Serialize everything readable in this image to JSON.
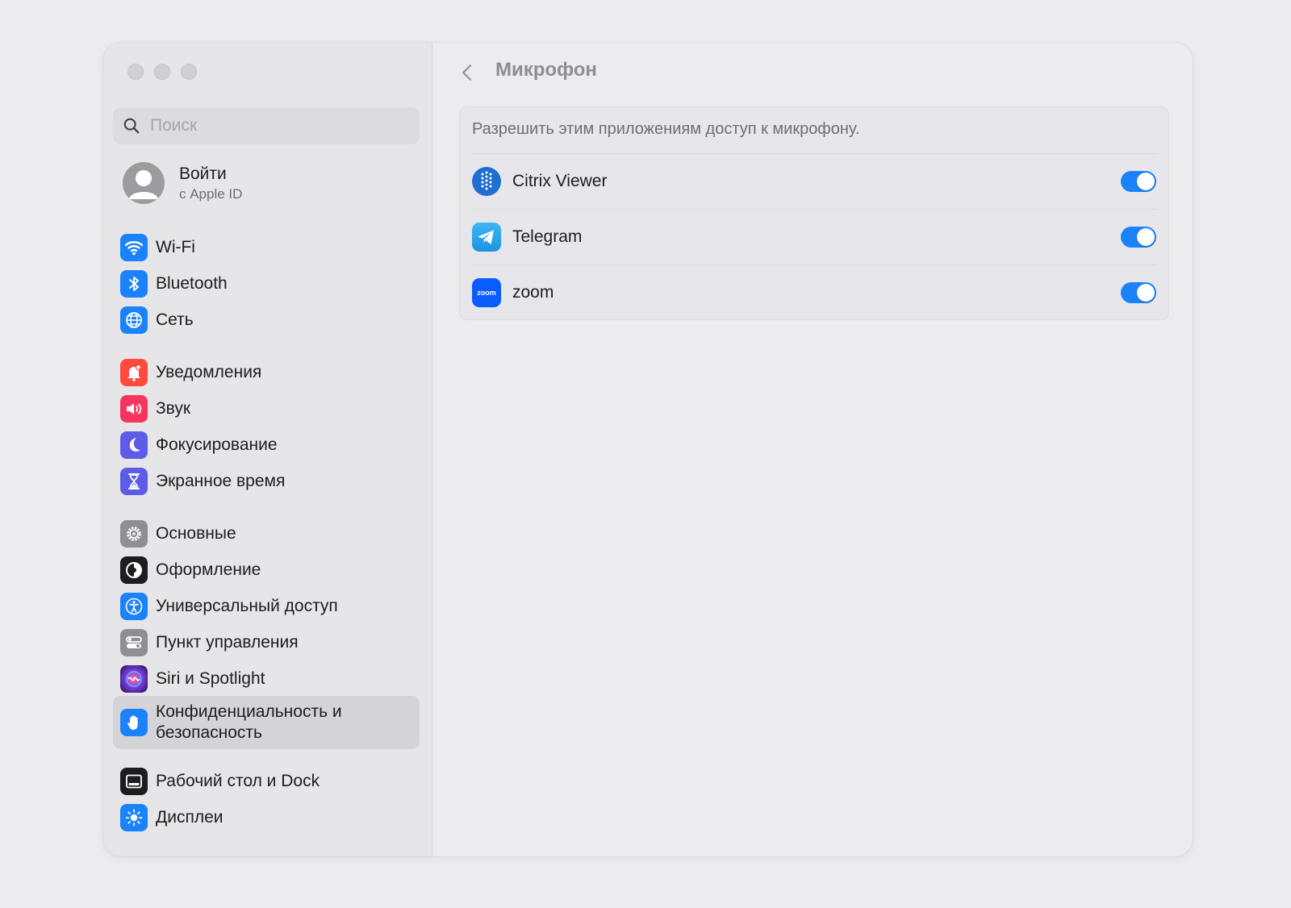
{
  "window": {
    "traffic_lights": [
      "close",
      "minimize",
      "zoom"
    ]
  },
  "sidebar": {
    "search": {
      "placeholder": "Поиск",
      "value": ""
    },
    "account": {
      "name": "Войти",
      "sub": "с Apple ID"
    },
    "items": [
      {
        "label": "Wi-Fi",
        "icon": "wifi-icon",
        "color": "#1a82fb"
      },
      {
        "label": "Bluetooth",
        "icon": "bluetooth-icon",
        "color": "#1a82fb"
      },
      {
        "label": "Сеть",
        "icon": "globe-icon",
        "color": "#1a82fb"
      },
      {
        "label": "Уведомления",
        "icon": "bell-icon",
        "color": "#ff4a3d"
      },
      {
        "label": "Звук",
        "icon": "speaker-icon",
        "color": "#f5355e"
      },
      {
        "label": "Фокусирование",
        "icon": "moon-icon",
        "color": "#5d5ce6"
      },
      {
        "label": "Экранное время",
        "icon": "hourglass-icon",
        "color": "#5d5ce6"
      },
      {
        "label": "Основные",
        "icon": "gear-icon",
        "color": "#8e8e93"
      },
      {
        "label": "Оформление",
        "icon": "appearance-icon",
        "color": "#1d1d1f"
      },
      {
        "label": "Универсальный доступ",
        "icon": "accessibility-icon",
        "color": "#1a82fb"
      },
      {
        "label": "Пункт управления",
        "icon": "switches-icon",
        "color": "#8e8e93"
      },
      {
        "label": "Siri и Spotlight",
        "icon": "siri-icon",
        "color": "#4a2b8a"
      },
      {
        "label": "Конфиденциальность и безопасность",
        "icon": "hand-icon",
        "color": "#1a82fb",
        "selected": true
      },
      {
        "label": "Рабочий стол и Dock",
        "icon": "dock-icon",
        "color": "#1d1d1f"
      },
      {
        "label": "Дисплеи",
        "icon": "sun-icon",
        "color": "#1a82fb"
      }
    ]
  },
  "main": {
    "title": "Микрофон",
    "description": "Разрешить этим приложениям доступ к микрофону.",
    "apps": [
      {
        "name": "Citrix Viewer",
        "icon": "citrix-icon",
        "enabled": true
      },
      {
        "name": "Telegram",
        "icon": "telegram-icon",
        "enabled": true
      },
      {
        "name": "zoom",
        "icon": "zoom-icon",
        "icon_text": "zoom",
        "enabled": true
      }
    ],
    "accent_color": "#1a82fb"
  }
}
